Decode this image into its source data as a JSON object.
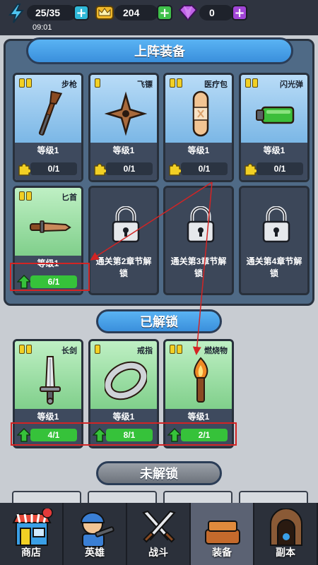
{
  "status": {
    "energy": "25/35",
    "crowns": "204",
    "gems": "0",
    "time": "09:01"
  },
  "colors": {
    "energy_plus": "#2fb8d8",
    "crown_plus": "#3fc04a",
    "gem_plus": "#a145d6",
    "card_blue": "#8ec6ef",
    "card_green": "#7fd08b",
    "progress_green": "#36c23a",
    "highlight_red": "#d32424"
  },
  "sections": {
    "equipped_title": "上阵装备",
    "unlocked_title": "已解锁",
    "locked_title": "未解锁"
  },
  "equipped": [
    {
      "name": "步枪",
      "icon": "rifle-icon",
      "level": "等级1",
      "progress": "0/1",
      "fill": 0,
      "color": "blue",
      "rarity": 2
    },
    {
      "name": "飞镖",
      "icon": "shuriken-icon",
      "level": "等级1",
      "progress": "0/1",
      "fill": 0,
      "color": "blue",
      "rarity": 1
    },
    {
      "name": "医疗包",
      "icon": "bandage-icon",
      "level": "等级1",
      "progress": "0/1",
      "fill": 0,
      "color": "blue",
      "rarity": 2
    },
    {
      "name": "闪光弹",
      "icon": "battery-icon",
      "level": "等级1",
      "progress": "0/1",
      "fill": 0,
      "color": "blue",
      "rarity": 2
    },
    {
      "name": "匕首",
      "icon": "dagger-icon",
      "level": "等级1",
      "progress": "6/1",
      "fill": 1,
      "color": "green",
      "rarity": 2
    }
  ],
  "locked_slots": [
    {
      "text": "通关第2章节解锁"
    },
    {
      "text": "通关第3章节解锁"
    },
    {
      "text": "通关第4章节解锁"
    }
  ],
  "unlocked": [
    {
      "name": "长剑",
      "icon": "sword-icon",
      "level": "等级1",
      "progress": "4/1",
      "fill": 1,
      "rarity": 2
    },
    {
      "name": "戒指",
      "icon": "ring-icon",
      "level": "等级1",
      "progress": "8/1",
      "fill": 1,
      "rarity": 1
    },
    {
      "name": "燃烧物",
      "icon": "torch-icon",
      "level": "等级1",
      "progress": "2/1",
      "fill": 1,
      "rarity": 2
    }
  ],
  "nav": [
    {
      "label": "商店",
      "icon": "shop-icon",
      "active": false
    },
    {
      "label": "英雄",
      "icon": "hero-icon",
      "active": false
    },
    {
      "label": "战斗",
      "icon": "crossed-swords-icon",
      "active": false
    },
    {
      "label": "装备",
      "icon": "equipment-icon",
      "active": true
    },
    {
      "label": "副本",
      "icon": "dungeon-icon",
      "active": false
    }
  ]
}
